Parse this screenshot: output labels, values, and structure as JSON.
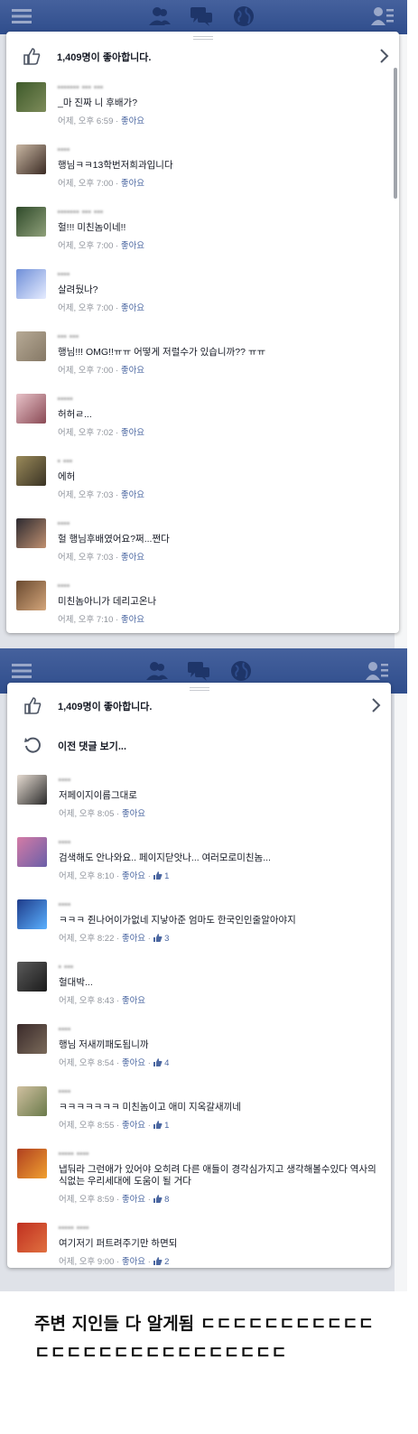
{
  "colors": {
    "header_blue": "#3b5998",
    "like_link": "#4b67a1",
    "meta_gray": "#90949c"
  },
  "icons": {
    "nav": [
      "menu-icon",
      "friends-icon",
      "messages-icon",
      "globe-icon",
      "contacts-icon"
    ],
    "likes": "thumbs-up-icon",
    "previous": "refresh-icon",
    "chevron": "chevron-right-icon"
  },
  "screen1": {
    "likes_text": "1,409명이 좋아합니다.",
    "comments": [
      {
        "name": "••••••• ••• •••",
        "text": "_마 진짜 니 후배가?",
        "time": "어제, 오후 6:59",
        "like": "좋아요",
        "count": ""
      },
      {
        "name": "••••",
        "text": "행님ㅋㅋ13학번저희과입니다",
        "time": "어제, 오후 7:00",
        "like": "좋아요",
        "count": ""
      },
      {
        "name": "••••••• ••• •••",
        "text": "헐!!! 미친놈이네!!",
        "time": "어제, 오후 7:00",
        "like": "좋아요",
        "count": ""
      },
      {
        "name": "••••",
        "text": "살려뒀나?",
        "time": "어제, 오후 7:00",
        "like": "좋아요",
        "count": ""
      },
      {
        "name": "••• •••",
        "text": "행님!!! OMG!!ㅠㅠ 어떻게 저럴수가 있습니까?? ㅠㅠ",
        "time": "어제, 오후 7:00",
        "like": "좋아요",
        "count": ""
      },
      {
        "name": "•••••",
        "text": "허허ㄹ...",
        "time": "어제, 오후 7:02",
        "like": "좋아요",
        "count": ""
      },
      {
        "name": "• •••",
        "text": "에허",
        "time": "어제, 오후 7:03",
        "like": "좋아요",
        "count": ""
      },
      {
        "name": "••••",
        "text": "헐 행님후배였어요?쩌...쩐다",
        "time": "어제, 오후 7:03",
        "like": "좋아요",
        "count": ""
      },
      {
        "name": "••••",
        "text": "미친놈아니가 데리고온나",
        "time": "어제, 오후 7:10",
        "like": "좋아요",
        "count": ""
      }
    ]
  },
  "screen2": {
    "likes_text": "1,409명이 좋아합니다.",
    "previous_text": "이전 댓글 보기...",
    "comments": [
      {
        "name": "••••",
        "text": "저페이지이름그대로",
        "time": "어제, 오후 8:05",
        "like": "좋아요",
        "count": ""
      },
      {
        "name": "••••",
        "text": "검색해도 안나와요.. 페이지닫앗나... 여러모로미친놈...",
        "time": "어제, 오후 8:10",
        "like": "좋아요",
        "count": "1"
      },
      {
        "name": "••••",
        "text": "ㅋㅋㅋ 쥔나어이가없네 지낳아준 엄마도 한국인인줄알아야지",
        "time": "어제, 오후 8:22",
        "like": "좋아요",
        "count": "3"
      },
      {
        "name": "• •••",
        "text": "헐대박...",
        "time": "어제, 오후 8:43",
        "like": "좋아요",
        "count": ""
      },
      {
        "name": "••••",
        "text": "행님 저새끼패도됩니까",
        "time": "어제, 오후 8:54",
        "like": "좋아요",
        "count": "4"
      },
      {
        "name": "••••",
        "text": "ㅋㅋㅋㅋㅋㅋㅋ 미친놈이고 애미 지옥갈새끼네",
        "time": "어제, 오후 8:55",
        "like": "좋아요",
        "count": "1"
      },
      {
        "name": "••••• ••••",
        "text": "냅둬라 그런애가 있어야 오히려 다른 애들이 경각심가지고 생각해볼수있다 역사의식없는 우리세대에 도움이 될 거다",
        "time": "어제, 오후 8:59",
        "like": "좋아요",
        "count": "8"
      },
      {
        "name": "••••• ••••",
        "text": "여기저기 퍼트려주기만 하면되",
        "time": "어제, 오후 9:00",
        "like": "좋아요",
        "count": "2"
      }
    ]
  },
  "caption": {
    "line1": "주변 지인들 다 알게됨 ㄷㄷㄷㄷㄷㄷㄷㄷㄷㄷㄷ",
    "line2": "ㄷㄷㄷㄷㄷㄷㄷㄷㄷㄷㄷㄷㄷㄷㄷㄷ"
  }
}
